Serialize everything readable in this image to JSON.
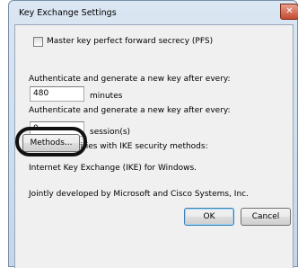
{
  "window": {
    "title": "Key Exchange Settings",
    "close_glyph": "✕"
  },
  "pfs": {
    "label": "Master key perfect forward secrecy (PFS)",
    "checked": false
  },
  "minutes": {
    "label": "Authenticate and generate a new key after every:",
    "value": "480",
    "unit": "minutes"
  },
  "sessions": {
    "label": "Authenticate and generate a new key after every:",
    "value": "0",
    "unit": "session(s)"
  },
  "methods": {
    "label": "Protect identities with IKE security methods:",
    "button": "Methods..."
  },
  "info": {
    "line1": "Internet Key Exchange (IKE) for Windows.",
    "line2": "Jointly developed by Microsoft and Cisco Systems, Inc."
  },
  "buttons": {
    "ok": "OK",
    "cancel": "Cancel"
  }
}
